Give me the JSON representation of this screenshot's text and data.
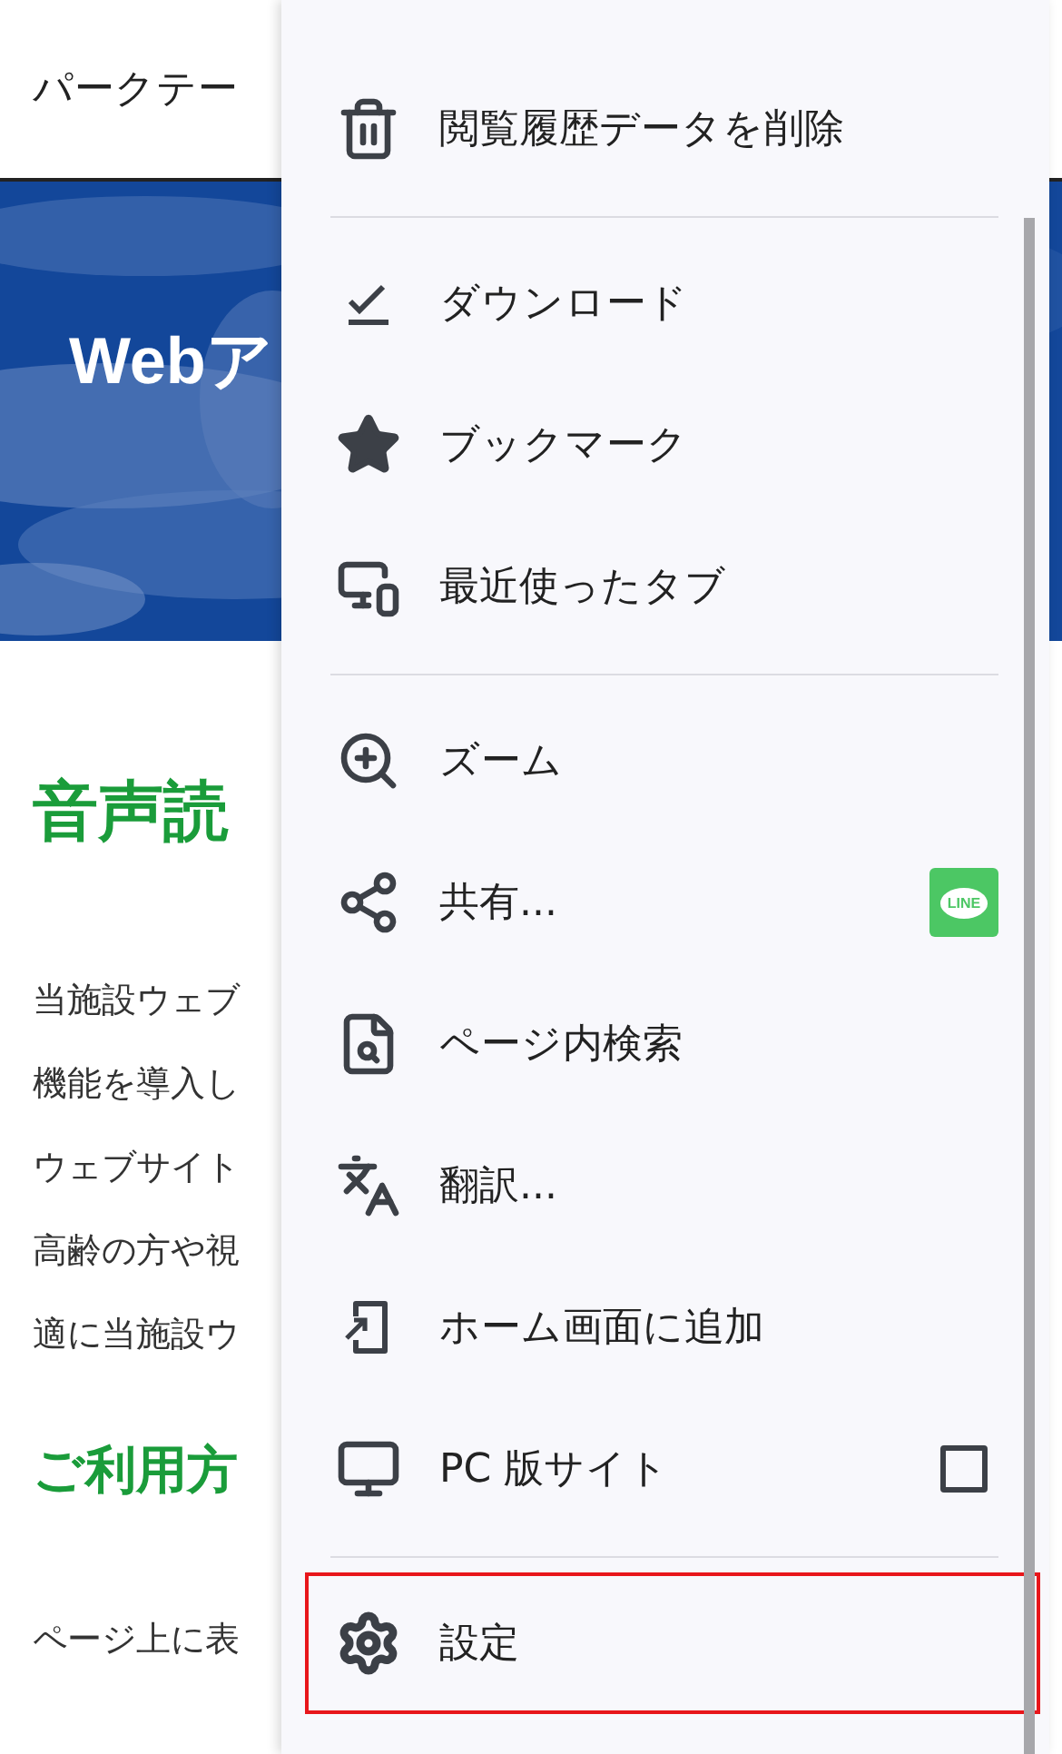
{
  "page": {
    "header_title": "パークテー",
    "hero_title": "Webア",
    "heading": "音声読",
    "paragraph_lines": [
      "当施設ウェブ",
      "機能を導入し",
      "ウェブサイト",
      "高齢の方や視",
      "適に当施設ウ"
    ],
    "subheading": "ご利用方",
    "body_line": "ページ上に表"
  },
  "menu": {
    "items": [
      {
        "kind": "item",
        "label": "閲覧履歴データを削除"
      },
      {
        "kind": "divider"
      },
      {
        "kind": "item",
        "label": "ダウンロード"
      },
      {
        "kind": "item",
        "label": "ブックマーク"
      },
      {
        "kind": "item",
        "label": "最近使ったタブ"
      },
      {
        "kind": "divider"
      },
      {
        "kind": "item",
        "label": "ズーム"
      },
      {
        "kind": "share",
        "label": "共有...",
        "badge": "LINE"
      },
      {
        "kind": "item",
        "label": "ページ内検索"
      },
      {
        "kind": "item",
        "label": "翻訳..."
      },
      {
        "kind": "item",
        "label": "ホーム画面に追加"
      },
      {
        "kind": "toggle",
        "label": "PC 版サイト",
        "checked": false
      },
      {
        "kind": "divider"
      },
      {
        "kind": "item",
        "label": "設定",
        "highlighted": true
      }
    ]
  }
}
